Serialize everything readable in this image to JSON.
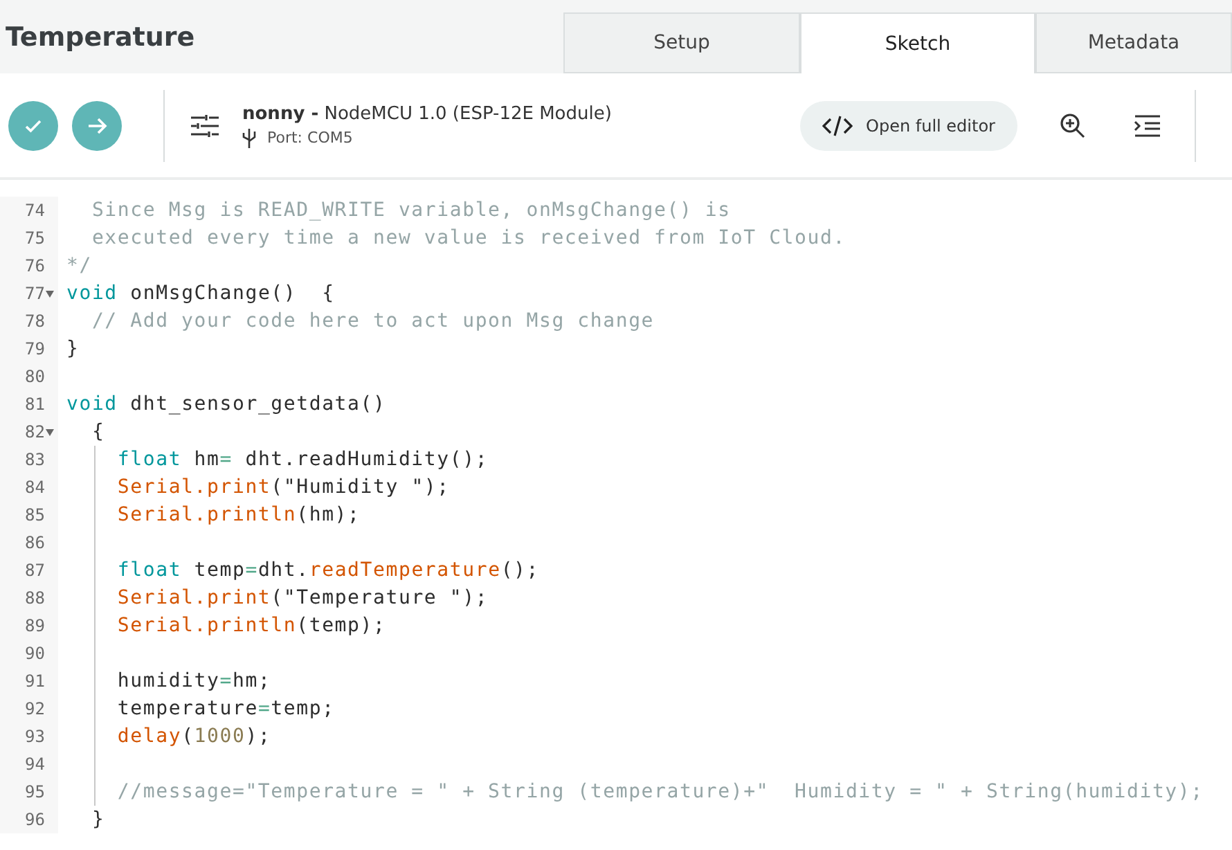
{
  "header": {
    "title": "Temperature"
  },
  "tabs": [
    {
      "label": "Setup",
      "selected": false
    },
    {
      "label": "Sketch",
      "selected": true
    },
    {
      "label": "Metadata",
      "selected": false
    }
  ],
  "toolbar": {
    "owner": "nonny -",
    "board": "NodeMCU 1.0 (ESP-12E Module)",
    "port": "Port: COM5",
    "editor_button": "Open full editor"
  },
  "editor": {
    "lines": [
      {
        "number": "74",
        "fold": false,
        "guide": false,
        "tokens": [
          {
            "kind": "comment",
            "text": "  Since Msg is READ_WRITE variable, onMsgChange() is"
          }
        ]
      },
      {
        "number": "75",
        "fold": false,
        "guide": false,
        "tokens": [
          {
            "kind": "comment",
            "text": "  executed every time a new value is received from IoT Cloud."
          }
        ]
      },
      {
        "number": "76",
        "fold": false,
        "guide": false,
        "tokens": [
          {
            "kind": "comment",
            "text": "*/"
          }
        ]
      },
      {
        "number": "77",
        "fold": true,
        "guide": false,
        "tokens": [
          {
            "kind": "keyword",
            "text": "void"
          },
          {
            "kind": "plain",
            "text": " onMsgChange()  {"
          }
        ]
      },
      {
        "number": "78",
        "fold": false,
        "guide": false,
        "tokens": [
          {
            "kind": "comment",
            "text": "  // Add your code here to act upon Msg change"
          }
        ]
      },
      {
        "number": "79",
        "fold": false,
        "guide": false,
        "tokens": [
          {
            "kind": "plain",
            "text": "}"
          }
        ]
      },
      {
        "number": "80",
        "fold": false,
        "guide": false
      },
      {
        "number": "81",
        "fold": false,
        "guide": false,
        "tokens": [
          {
            "kind": "keyword",
            "text": "void"
          },
          {
            "kind": "plain",
            "text": " dht_sensor_getdata()"
          }
        ]
      },
      {
        "number": "82",
        "fold": true,
        "guide": false,
        "tokens": [
          {
            "kind": "plain",
            "text": "  {"
          }
        ]
      },
      {
        "number": "83",
        "fold": false,
        "guide": true,
        "tokens": [
          {
            "kind": "keyword",
            "text": "    float"
          },
          {
            "kind": "plain",
            "text": " hm"
          },
          {
            "kind": "operator",
            "text": "="
          },
          {
            "kind": "plain",
            "text": " dht.readHumidity();"
          }
        ]
      },
      {
        "number": "84",
        "fold": false,
        "guide": true,
        "tokens": [
          {
            "kind": "function",
            "text": "    Serial.print"
          },
          {
            "kind": "plain",
            "text": "(\"Humidity \");"
          }
        ]
      },
      {
        "number": "85",
        "fold": false,
        "guide": true,
        "tokens": [
          {
            "kind": "function",
            "text": "    Serial.println"
          },
          {
            "kind": "plain",
            "text": "(hm);"
          }
        ]
      },
      {
        "number": "86",
        "fold": false,
        "guide": true
      },
      {
        "number": "87",
        "fold": false,
        "guide": true,
        "tokens": [
          {
            "kind": "keyword",
            "text": "    float"
          },
          {
            "kind": "plain",
            "text": " temp"
          },
          {
            "kind": "operator",
            "text": "="
          },
          {
            "kind": "plain",
            "text": "dht."
          },
          {
            "kind": "function",
            "text": "readTemperature"
          },
          {
            "kind": "plain",
            "text": "();"
          }
        ]
      },
      {
        "number": "88",
        "fold": false,
        "guide": true,
        "tokens": [
          {
            "kind": "function",
            "text": "    Serial.print"
          },
          {
            "kind": "plain",
            "text": "(\"Temperature \");"
          }
        ]
      },
      {
        "number": "89",
        "fold": false,
        "guide": true,
        "tokens": [
          {
            "kind": "function",
            "text": "    Serial.println"
          },
          {
            "kind": "plain",
            "text": "(temp);"
          }
        ]
      },
      {
        "number": "90",
        "fold": false,
        "guide": true
      },
      {
        "number": "91",
        "fold": false,
        "guide": true,
        "tokens": [
          {
            "kind": "plain",
            "text": "    humidity"
          },
          {
            "kind": "operator",
            "text": "="
          },
          {
            "kind": "plain",
            "text": "hm;"
          }
        ]
      },
      {
        "number": "92",
        "fold": false,
        "guide": true,
        "tokens": [
          {
            "kind": "plain",
            "text": "    temperature"
          },
          {
            "kind": "operator",
            "text": "="
          },
          {
            "kind": "plain",
            "text": "temp;"
          }
        ]
      },
      {
        "number": "93",
        "fold": false,
        "guide": true,
        "tokens": [
          {
            "kind": "function",
            "text": "    delay"
          },
          {
            "kind": "plain",
            "text": "("
          },
          {
            "kind": "number",
            "text": "1000"
          },
          {
            "kind": "plain",
            "text": ");"
          }
        ]
      },
      {
        "number": "94",
        "fold": false,
        "guide": true
      },
      {
        "number": "95",
        "fold": false,
        "guide": true,
        "tokens": [
          {
            "kind": "comment",
            "text": "    //message=\"Temperature = \" + String (temperature)+\"  Humidity = \" + String(humidity);"
          }
        ]
      },
      {
        "number": "96",
        "fold": false,
        "guide": false,
        "tokens": [
          {
            "kind": "plain",
            "text": "  }"
          }
        ]
      }
    ]
  }
}
